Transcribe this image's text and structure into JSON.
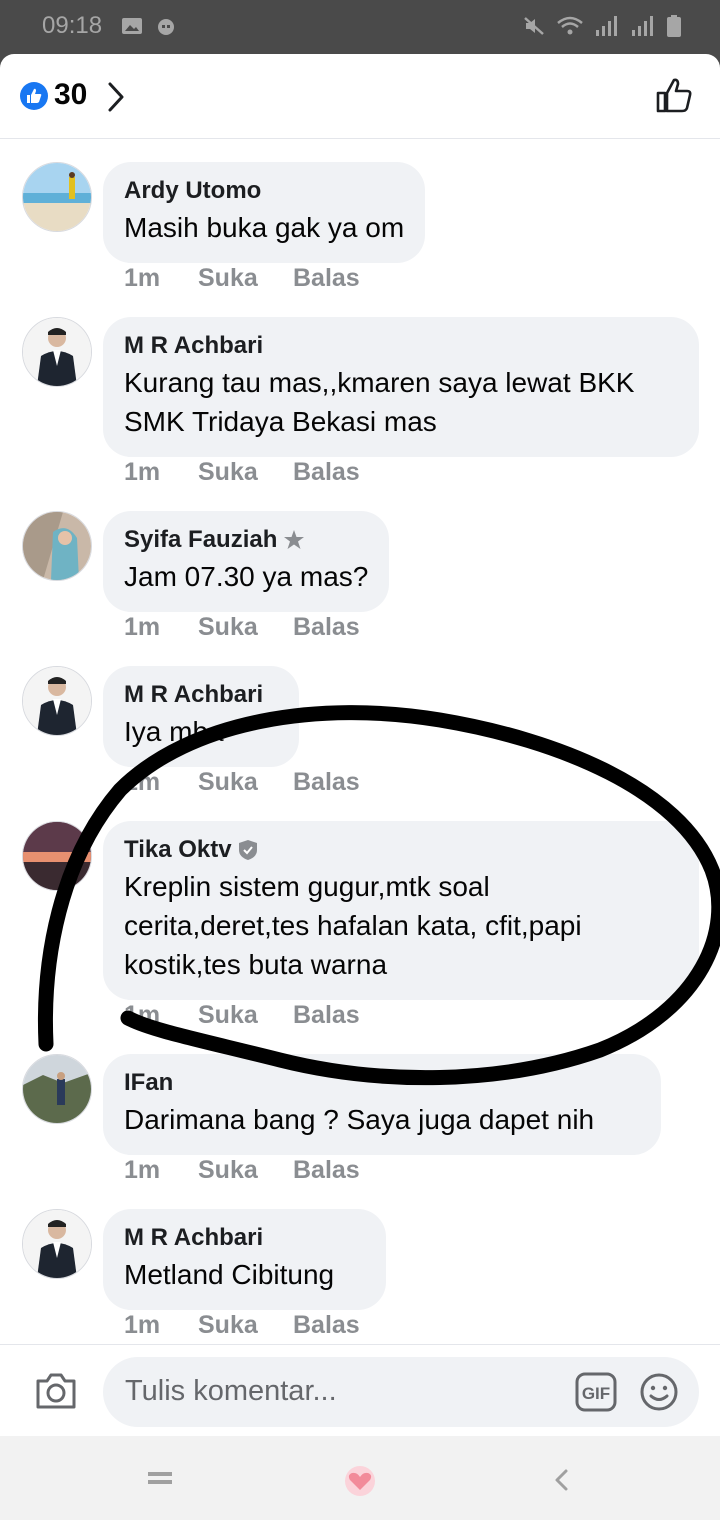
{
  "status_bar": {
    "time": "09:18"
  },
  "header": {
    "reaction_count": "30"
  },
  "comments": [
    {
      "name": "Ardy Utomo",
      "text": "Masih buka gak ya om",
      "time": "1m",
      "like": "Suka",
      "reply": "Balas"
    },
    {
      "name": "M R Achbari",
      "text": "Kurang tau mas,,kmaren saya lewat BKK SMK Tridaya Bekasi mas",
      "time": "1m",
      "like": "Suka",
      "reply": "Balas"
    },
    {
      "name": "Syifa Fauziah",
      "text": "Jam 07.30 ya mas?",
      "time": "1m",
      "like": "Suka",
      "reply": "Balas"
    },
    {
      "name": "M R Achbari",
      "text": "Iya mba",
      "time": "1m",
      "like": "Suka",
      "reply": "Balas"
    },
    {
      "name": "Tika Oktv",
      "text": "Kreplin sistem gugur,mtk soal cerita,deret,tes hafalan kata, cfit,papi kostik,tes buta warna",
      "time": "1m",
      "like": "Suka",
      "reply": "Balas"
    },
    {
      "name": "IFan",
      "text": "Darimana bang ? Saya juga dapet nih",
      "time": "1m",
      "like": "Suka",
      "reply": "Balas"
    },
    {
      "name": "M R Achbari",
      "text": "Metland Cibitung",
      "time": "1m",
      "like": "Suka",
      "reply": "Balas"
    }
  ],
  "composer": {
    "placeholder": "Tulis komentar...",
    "gif_label": "GIF"
  },
  "colors": {
    "accent": "#1877f2",
    "bubble": "#f0f2f5",
    "meta_gray": "#8a8d91",
    "status_bar": "#4a4a4a",
    "heart": "#f28b9a"
  },
  "icons": [
    "like-badge-icon",
    "chevron-right-icon",
    "thumbs-up-icon",
    "camera-icon",
    "gif-icon",
    "emoji-icon",
    "star-badge-icon",
    "verified-badge-icon",
    "menu-icon",
    "heart-icon",
    "back-icon"
  ]
}
